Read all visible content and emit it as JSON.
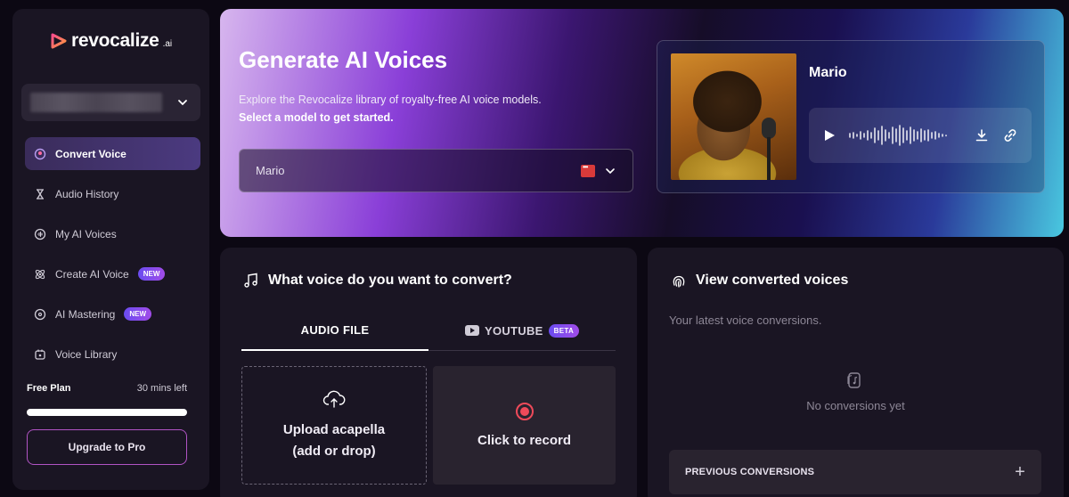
{
  "brand": {
    "name": "revocalize",
    "suffix": ".ai"
  },
  "sidebar": {
    "nav": [
      {
        "label": "Convert Voice",
        "icon": "mic-icon",
        "active": true
      },
      {
        "label": "Audio History",
        "icon": "hourglass-icon"
      },
      {
        "label": "My AI Voices",
        "icon": "voice-icon"
      },
      {
        "label": "Create AI Voice",
        "icon": "atom-icon",
        "badge": "NEW"
      },
      {
        "label": "AI Mastering",
        "icon": "disc-icon",
        "badge": "NEW"
      },
      {
        "label": "Voice Library",
        "icon": "library-icon"
      }
    ],
    "plan": {
      "name": "Free Plan",
      "remaining": "30 mins left",
      "progress": 1.0
    },
    "upgrade_label": "Upgrade to Pro"
  },
  "hero": {
    "title": "Generate AI Voices",
    "description": "Explore the Revocalize library of royalty-free AI voice models.",
    "description_bold": "Select a model to get started.",
    "select_value": "Mario",
    "voice_card": {
      "name": "Mario"
    }
  },
  "convert": {
    "title": "What voice do you want to convert?",
    "tabs": [
      {
        "label": "AUDIO FILE",
        "active": true
      },
      {
        "label": "YOUTUBE",
        "badge": "BETA"
      }
    ],
    "upload_label": "Upload acapella\n(add or drop)",
    "record_label": "Click to record"
  },
  "converted": {
    "title": "View converted voices",
    "subtitle": "Your latest voice conversions.",
    "empty_text": "No conversions yet",
    "previous_label": "PREVIOUS CONVERSIONS",
    "previous_toggle": "+"
  },
  "colors": {
    "accent": "#8a3fd8",
    "badge": "#a14ce8",
    "record": "#ef4a5a",
    "panel": "#1a1523"
  }
}
